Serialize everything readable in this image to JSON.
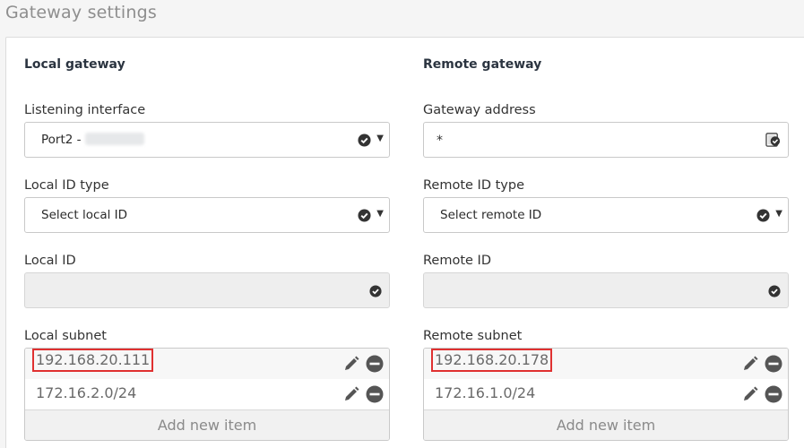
{
  "page": {
    "title": "Gateway settings"
  },
  "local": {
    "heading": "Local gateway",
    "listening_interface": {
      "label": "Listening interface",
      "value": "Port2 -"
    },
    "id_type": {
      "label": "Local ID type",
      "value": "Select local ID"
    },
    "id": {
      "label": "Local ID",
      "value": ""
    },
    "subnet": {
      "label": "Local subnet",
      "items": [
        "192.168.20.111",
        "172.16.2.0/24"
      ],
      "add_label": "Add new item"
    }
  },
  "remote": {
    "heading": "Remote gateway",
    "gateway_address": {
      "label": "Gateway address",
      "value": "*"
    },
    "id_type": {
      "label": "Remote ID type",
      "value": "Select remote ID"
    },
    "id": {
      "label": "Remote ID",
      "value": ""
    },
    "subnet": {
      "label": "Remote subnet",
      "items": [
        "192.168.20.178",
        "172.16.1.0/24"
      ],
      "add_label": "Add new item"
    }
  },
  "colors": {
    "highlight": "#e03131",
    "icon": "#555555",
    "panel_bg": "#ffffff"
  }
}
